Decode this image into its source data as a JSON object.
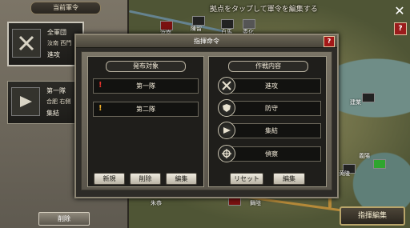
{
  "map": {
    "hint": "拠点をタップして軍令を編集する",
    "labels": [
      "白馬",
      "委化",
      "汝南",
      "陳留",
      "建業",
      "黄陵",
      "義陽",
      "舞陰",
      "朱恭"
    ]
  },
  "left_panel": {
    "title": "当前軍令",
    "units": [
      {
        "name": "全軍団",
        "location": "汝南 西門",
        "order": "進攻",
        "icon": "crossed-swords-icon"
      },
      {
        "name": "第一隊",
        "location": "合肥 右側",
        "order": "集結",
        "icon": "flag-icon"
      }
    ],
    "delete_label": "削除"
  },
  "dialog": {
    "title": "指揮命令",
    "help": "?",
    "left": {
      "title": "発布対象",
      "rows": [
        {
          "label": "第一隊",
          "mark": "!",
          "mark_color": "#e0322c"
        },
        {
          "label": "第二隊",
          "mark": "!",
          "mark_color": "#e7a92a"
        }
      ],
      "buttons": [
        "新規",
        "削除",
        "編集"
      ]
    },
    "right": {
      "title": "作戦内容",
      "rows": [
        {
          "label": "進攻",
          "icon": "crossed-swords-icon"
        },
        {
          "label": "防守",
          "icon": "shield-icon"
        },
        {
          "label": "集結",
          "icon": "flag-icon"
        },
        {
          "label": "偵察",
          "icon": "crosshair-icon"
        }
      ],
      "buttons": [
        "リセット",
        "編集"
      ]
    }
  },
  "top_right": {
    "close": "✕",
    "help": "?"
  },
  "command_edit_label": "指揮編集"
}
